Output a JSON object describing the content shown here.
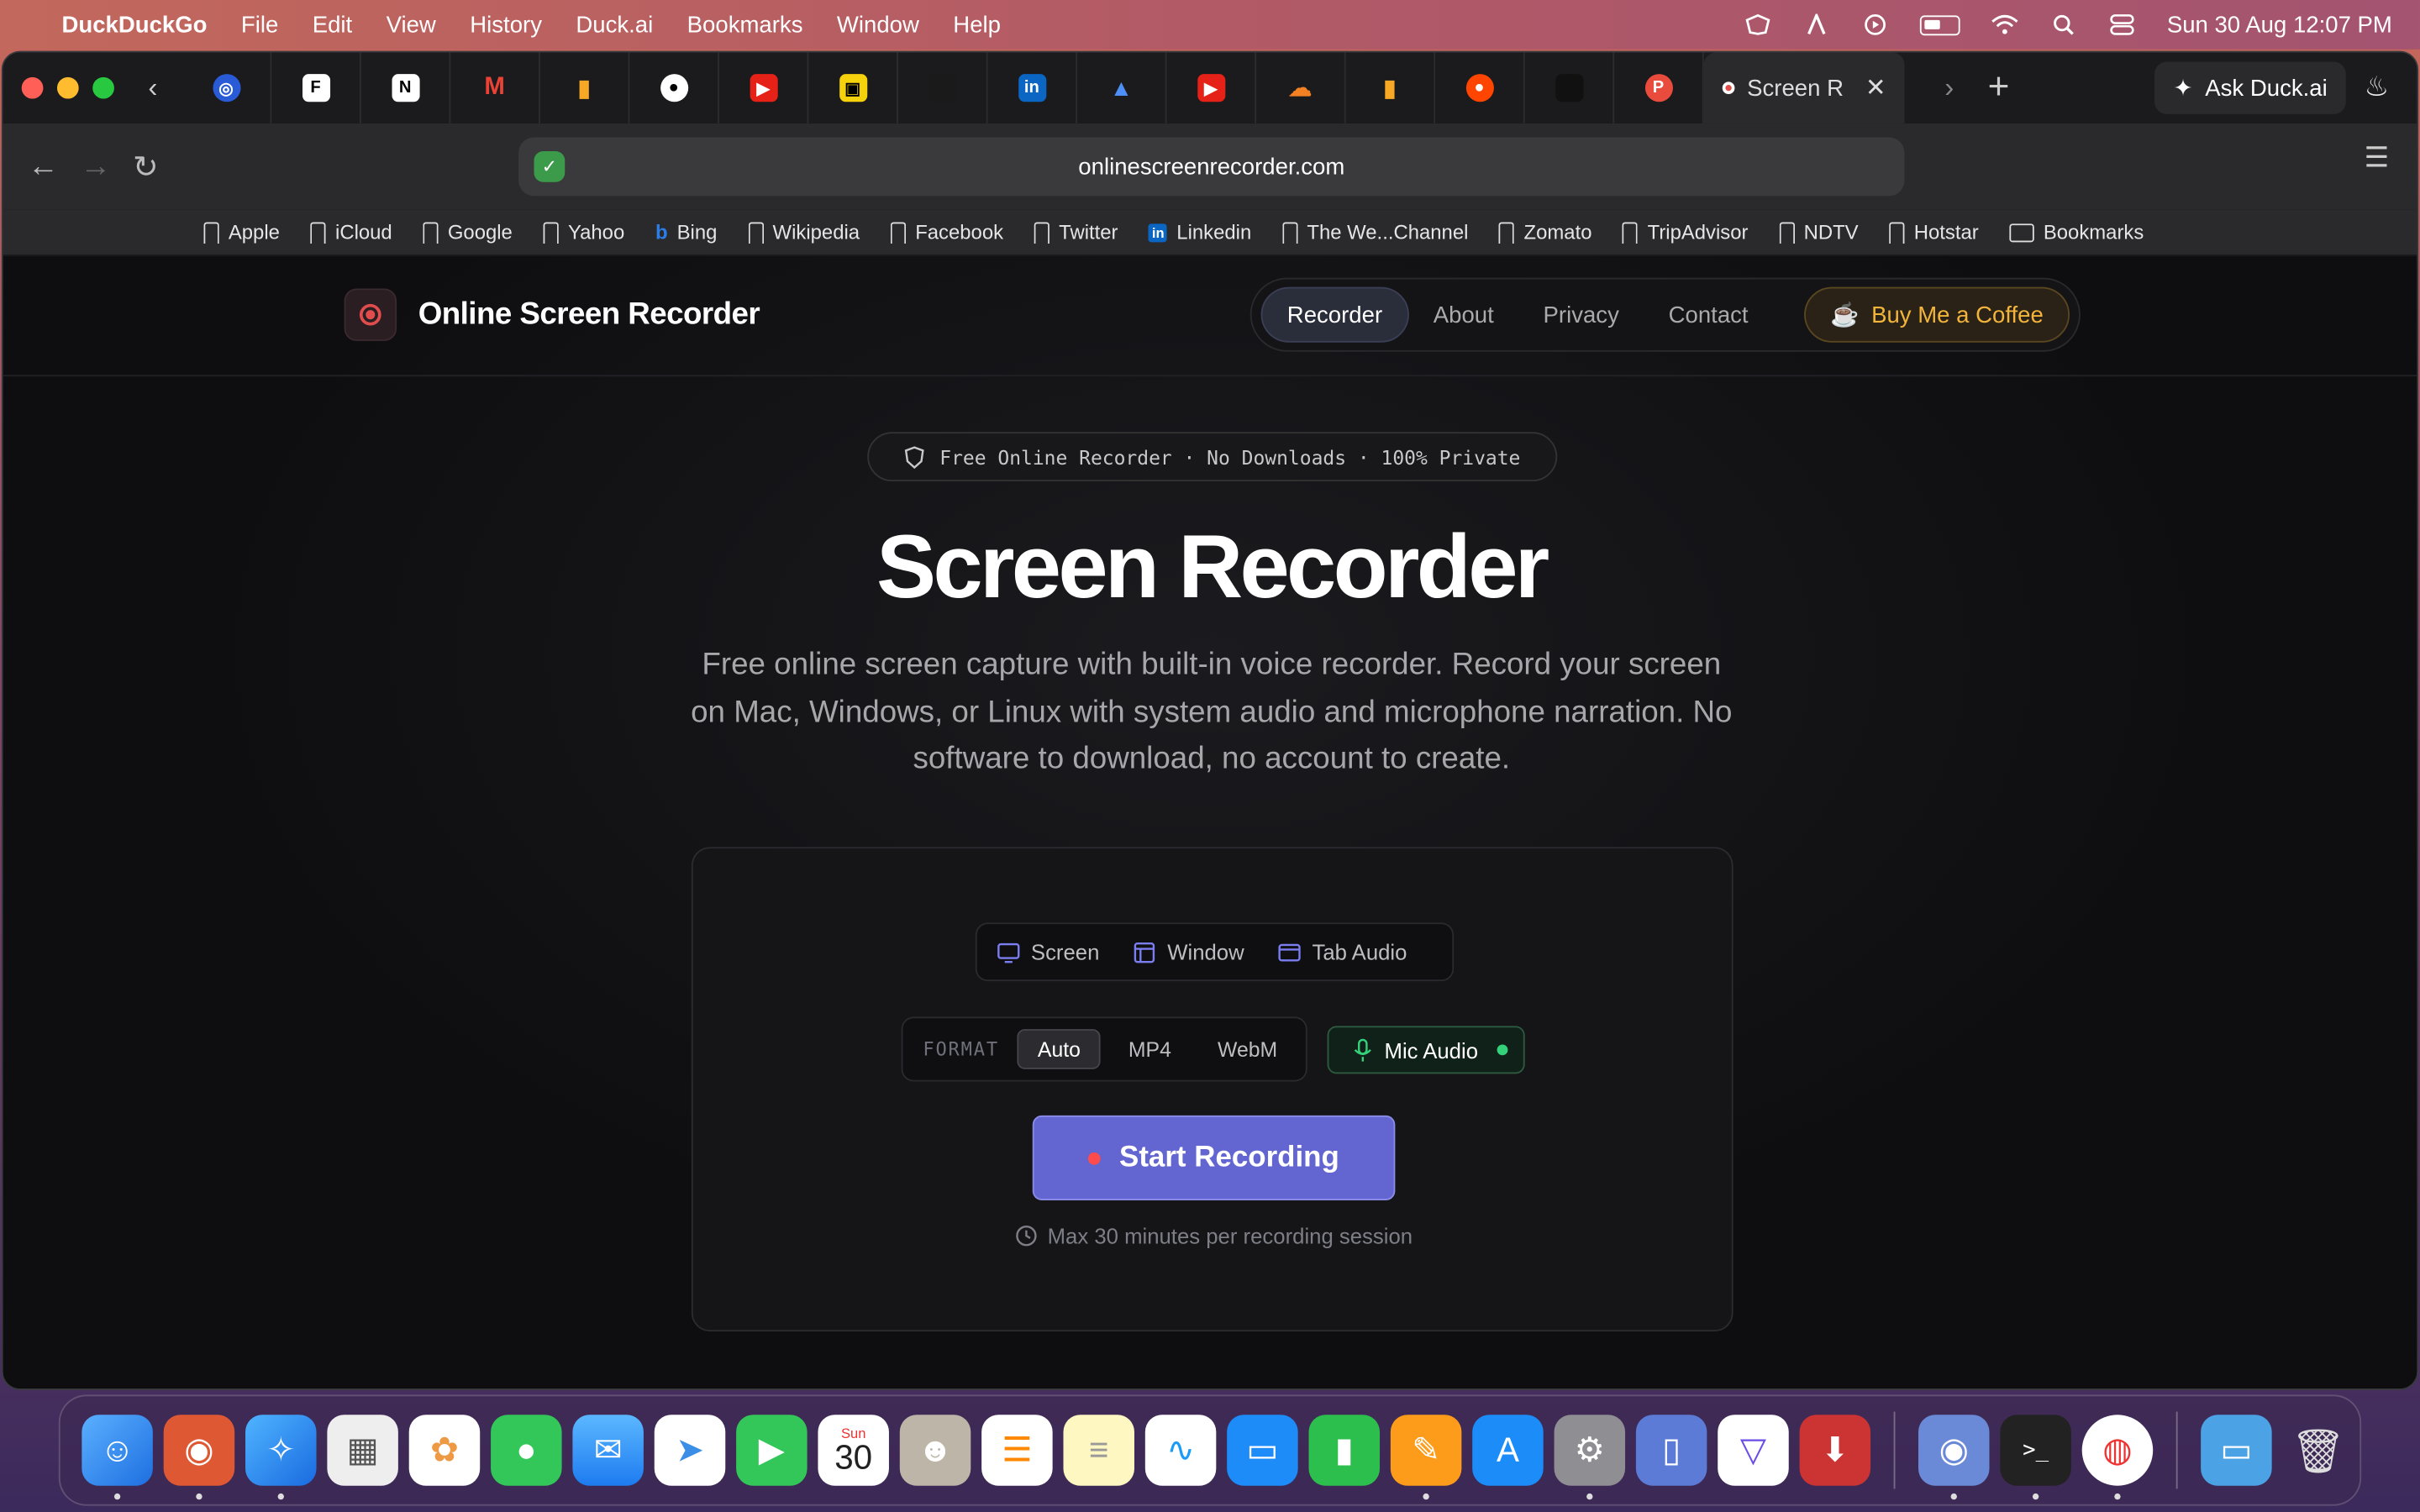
{
  "menubar": {
    "app_name": "DuckDuckGo",
    "items": [
      "File",
      "Edit",
      "View",
      "History",
      "Duck.ai",
      "Bookmarks",
      "Window",
      "Help"
    ],
    "datetime": "Sun 30 Aug  12:07 PM"
  },
  "tabs": {
    "active_title": "Screen R",
    "ask_duck": "Ask Duck.ai"
  },
  "address": {
    "url": "onlinescreenrecorder.com"
  },
  "bookmarks": [
    "Apple",
    "iCloud",
    "Google",
    "Yahoo",
    "Bing",
    "Wikipedia",
    "Facebook",
    "Twitter",
    "Linkedin",
    "The We...Channel",
    "Zomato",
    "TripAdvisor",
    "NDTV",
    "Hotstar",
    "Bookmarks"
  ],
  "site": {
    "logo_text": "Online Screen Recorder",
    "nav": [
      "Recorder",
      "About",
      "Privacy",
      "Contact"
    ],
    "coffee": "Buy Me a Coffee",
    "badge": "Free Online Recorder · No Downloads · 100% Private",
    "title": "Screen Recorder",
    "subtitle": "Free online screen capture with built-in voice recorder. Record your screen on Mac, Windows, or Linux with system audio and microphone narration. No software to download, no account to create."
  },
  "recorder": {
    "modes": [
      "Screen",
      "Window",
      "Tab Audio"
    ],
    "format_label": "FORMAT",
    "formats": [
      "Auto",
      "MP4",
      "WebM"
    ],
    "selected_format": "Auto",
    "mic_label": "Mic Audio",
    "start_label": "Start Recording",
    "max_note": "Max 30 minutes per recording session"
  },
  "dock": {
    "calendar_day": "Sun",
    "calendar_date": "30"
  },
  "colors": {
    "accent": "#6366d1",
    "record_red": "#e14d4d",
    "coffee_gold": "#f2b43a",
    "mic_green": "#33d17a"
  }
}
